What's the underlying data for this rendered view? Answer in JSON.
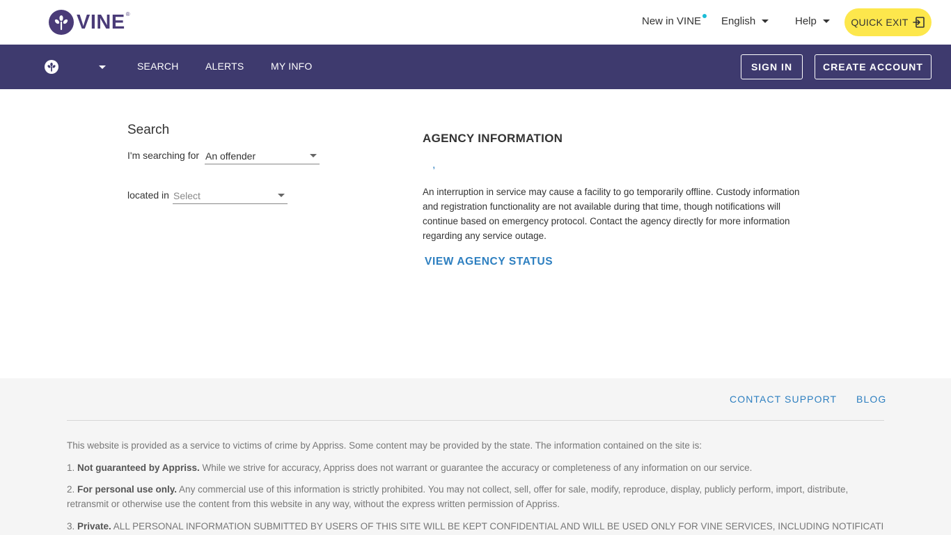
{
  "header": {
    "logo_text": "VINE",
    "logo_reg": "®",
    "new_in_vine": "New in VINE",
    "language": "English",
    "help": "Help",
    "quick_exit": "QUICK EXIT"
  },
  "nav": {
    "items": [
      "SEARCH",
      "ALERTS",
      "MY INFO"
    ],
    "sign_in": "SIGN IN",
    "create_account": "CREATE ACCOUNT"
  },
  "search": {
    "title": "Search",
    "searching_for_label": "I'm searching for",
    "searching_for_value": "An offender",
    "located_in_label": "located in",
    "located_in_placeholder": "Select"
  },
  "agency": {
    "title": "AGENCY INFORMATION",
    "separator": ",",
    "notice": "An interruption in service may cause a facility to go temporarily offline. Custody information and registration functionality are not available during that time, though notifications will continue based on emergency protocol. Contact the agency directly for more information regarding any service outage.",
    "status_link": "VIEW AGENCY STATUS"
  },
  "footer": {
    "contact_support": "CONTACT SUPPORT",
    "blog": "BLOG",
    "intro": "This website is provided as a service to victims of crime by Appriss. Some content may be provided by the state. The information contained on the site is:",
    "items": [
      {
        "lead": "1. ",
        "bold": "Not guaranteed by Appriss.",
        "text": " While we strive for accuracy, Appriss does not warrant or guarantee the accuracy or completeness of any information on our service."
      },
      {
        "lead": "2. ",
        "bold": "For personal use only.",
        "text": " Any commercial use of this information is strictly prohibited. You may not collect, sell, offer for sale, modify, reproduce, display, publicly perform, import, distribute, retransmit or otherwise use the content from this website in any way, without the express written permission of Appriss."
      },
      {
        "lead": "3. ",
        "bold": "Private.",
        "text": " ALL PERSONAL INFORMATION SUBMITTED BY USERS OF THIS SITE WILL BE KEPT CONFIDENTIAL AND WILL BE USED ONLY FOR VINE SERVICES, INCLUDING NOTIFICATION"
      }
    ]
  },
  "colors": {
    "brand_purple": "#4a3b78",
    "nav_bg": "#3e3a6e",
    "quick_exit_bg": "#fde74c",
    "link_blue": "#2d7fc0",
    "dot_cyan": "#1bbcd6",
    "footer_bg": "#f5f5f5"
  },
  "icons": {
    "logo": "vine-logo-icon",
    "quick_exit": "exit-door-icon"
  }
}
